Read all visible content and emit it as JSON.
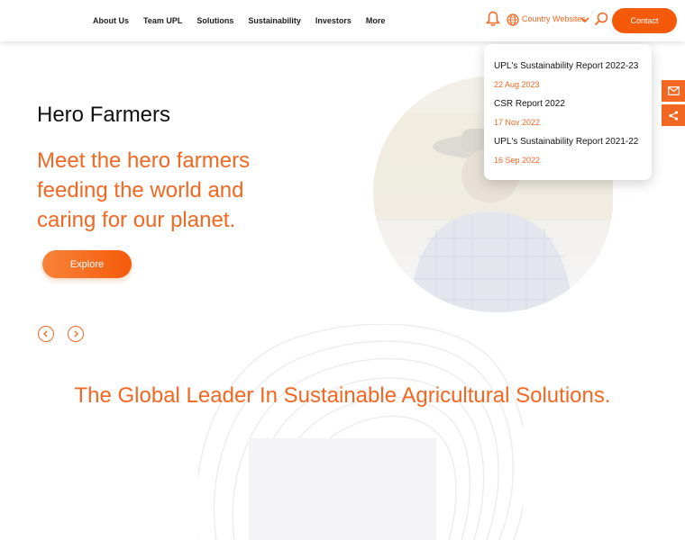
{
  "nav": {
    "items": [
      "About Us",
      "Team UPL",
      "Solutions",
      "Sustainability",
      "Investors",
      "More"
    ]
  },
  "header": {
    "country_label": "Country Websites",
    "contact_label": "Contact"
  },
  "dropdown": {
    "items": [
      {
        "title": "UPL's Sustainability Report 2022-23",
        "date": "22 Aug 2023"
      },
      {
        "title": "CSR Report 2022",
        "date": "17 Nov 2022"
      },
      {
        "title": "UPL's Sustainability Report 2021-22",
        "date": "16 Sep 2022"
      }
    ]
  },
  "hero": {
    "title": "Hero Farmers",
    "subtitle": "Meet the hero farmers feeding the world and caring for our planet.",
    "cta": "Explore"
  },
  "tagline": "The Global Leader In Sustainable Agricultural Solutions.",
  "icons": {
    "bell": "bell-icon",
    "globe": "globe-icon",
    "search": "search-icon",
    "mail": "mail-icon",
    "share": "share-icon",
    "prev": "chevron-left-icon",
    "next": "chevron-right-icon"
  },
  "colors": {
    "accent": "#f26722",
    "button": "#f55a0a"
  }
}
